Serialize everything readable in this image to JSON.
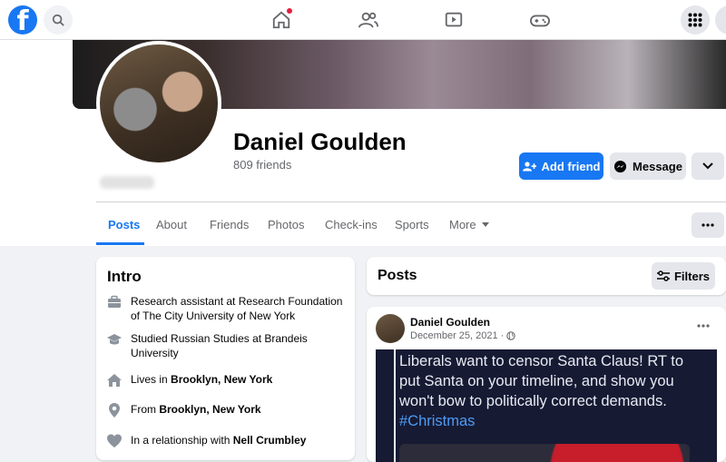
{
  "nav": {
    "logo_letter": "f",
    "icons": [
      "search-icon",
      "home-icon",
      "friends-icon",
      "watch-icon",
      "gaming-icon",
      "menu-grid-icon"
    ],
    "notification_color": "#e41e3f"
  },
  "profile": {
    "name": "Daniel Goulden",
    "friends_count": "809 friends",
    "add_friend_label": "Add friend",
    "message_label": "Message"
  },
  "tabs": [
    {
      "label": "Posts",
      "active": true
    },
    {
      "label": "About"
    },
    {
      "label": "Friends"
    },
    {
      "label": "Photos"
    },
    {
      "label": "Check-ins"
    },
    {
      "label": "Sports"
    },
    {
      "label": "More"
    }
  ],
  "intro": {
    "title": "Intro",
    "work": "Research assistant at Research Foundation of The City University of New York",
    "education": "Studied Russian Studies at Brandeis University",
    "lives_prefix": "Lives in ",
    "lives_place": "Brooklyn, New York",
    "from_prefix": "From ",
    "from_place": "Brooklyn, New York",
    "relationship_prefix": "In a relationship with ",
    "relationship_name": "Nell Crumbley"
  },
  "posts": {
    "title": "Posts",
    "filters_label": "Filters",
    "post": {
      "author": "Daniel Goulden",
      "date": "December 25, 2021 ·",
      "text": "Liberals want to censor Santa Claus! RT to put Santa on your timeline, and show you won't bow to politically correct demands.",
      "hashtag": "#Christmas"
    }
  },
  "colors": {
    "accent": "#1877f2",
    "background": "#f0f2f5",
    "button_gray": "#e4e6eb"
  }
}
